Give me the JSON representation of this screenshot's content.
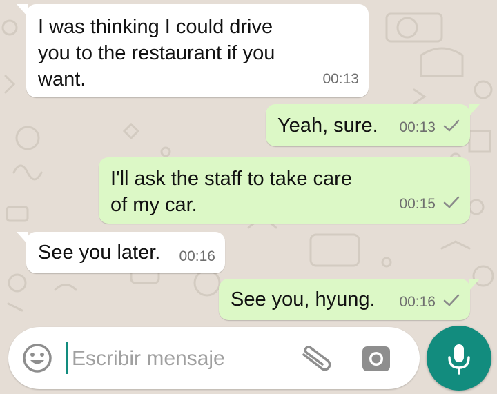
{
  "theme": {
    "wallpaper": "#e5ddd5",
    "incoming_bubble": "#ffffff",
    "outgoing_bubble": "#dcf8c6",
    "accent": "#128c7e"
  },
  "messages": [
    {
      "direction": "incoming",
      "lines": [
        "I was thinking I could drive",
        "you to the restaurant if you",
        "want."
      ],
      "time": "00:13"
    },
    {
      "direction": "outgoing",
      "lines": [
        "Yeah, sure."
      ],
      "time": "00:13",
      "status": "sent"
    },
    {
      "direction": "outgoing",
      "lines": [
        "I'll ask the staff to take care",
        "of my car."
      ],
      "time": "00:15",
      "status": "sent"
    },
    {
      "direction": "incoming",
      "lines": [
        "See you later."
      ],
      "time": "00:16"
    },
    {
      "direction": "outgoing",
      "lines": [
        "See you, hyung."
      ],
      "time": "00:16",
      "status": "sent"
    }
  ],
  "composer": {
    "placeholder": "Escribir mensaje",
    "value": "",
    "icons": {
      "emoji": "emoji-icon",
      "attach": "paperclip-icon",
      "camera": "camera-icon",
      "send": "microphone-icon"
    }
  },
  "status_icons": {
    "sent": "single-check-icon"
  }
}
